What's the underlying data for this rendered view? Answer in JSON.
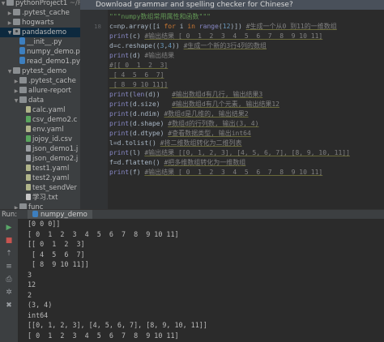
{
  "project_tree": {
    "items": [
      {
        "label": "pythonProject1",
        "suffix": "~/Pyt",
        "icon": "folder-icon",
        "indent": 0,
        "arrow": "down"
      },
      {
        "label": ".pytest_cache",
        "icon": "folder-icon",
        "indent": 1,
        "arrow": "right"
      },
      {
        "label": "hogwarts",
        "icon": "folder-icon",
        "indent": 1,
        "arrow": "right"
      },
      {
        "label": "pandasdemo",
        "icon": "package-icon",
        "indent": 1,
        "arrow": "down",
        "selected": true
      },
      {
        "label": "__init__.py",
        "icon": "python-file-icon",
        "indent": 2
      },
      {
        "label": "numpy_demo.py",
        "icon": "python-file-icon",
        "indent": 2
      },
      {
        "label": "read_demo1.py",
        "icon": "python-file-icon",
        "indent": 2
      },
      {
        "label": "pytest_demo",
        "icon": "folder-icon",
        "indent": 1,
        "arrow": "down"
      },
      {
        "label": ".pytest_cache",
        "icon": "folder-icon",
        "indent": 2,
        "arrow": "right"
      },
      {
        "label": "allure-report",
        "icon": "folder-icon",
        "indent": 2,
        "arrow": "right"
      },
      {
        "label": "data",
        "icon": "folder-icon",
        "indent": 2,
        "arrow": "down"
      },
      {
        "label": "calc.yaml",
        "icon": "yaml-file-icon",
        "indent": 3
      },
      {
        "label": "csv_demo2.c",
        "icon": "csv-file-icon",
        "indent": 3
      },
      {
        "label": "env.yaml",
        "icon": "yaml-file-icon",
        "indent": 3
      },
      {
        "label": "jojoy_id.csv",
        "icon": "csv-file-icon",
        "indent": 3
      },
      {
        "label": "json_demo1.j",
        "icon": "file-icon",
        "indent": 3
      },
      {
        "label": "json_demo2.j",
        "icon": "file-icon",
        "indent": 3
      },
      {
        "label": "test1.yaml",
        "icon": "yaml-file-icon",
        "indent": 3
      },
      {
        "label": "test2.yaml",
        "icon": "yaml-file-icon",
        "indent": 3
      },
      {
        "label": "test_sendVer",
        "icon": "yaml-file-icon",
        "indent": 3
      },
      {
        "label": "学习.txt",
        "icon": "text-file-icon",
        "indent": 3
      },
      {
        "label": "func",
        "icon": "folder-icon",
        "indent": 2,
        "arrow": "right"
      },
      {
        "label": "log",
        "icon": "folder-icon",
        "indent": 2,
        "arrow": "right"
      }
    ]
  },
  "notification": {
    "text": "Download grammar and spelling checker for Chinese?"
  },
  "editor": {
    "line_numbers": [
      "",
      "18",
      "",
      "",
      "",
      "",
      "",
      "",
      "",
      "",
      "",
      "",
      "",
      "",
      "",
      "",
      "",
      "",
      "",
      "",
      ""
    ],
    "lines": [
      {
        "segments": [
          {
            "t": "\"\"\"numpy数组常用属性和函数\"\"\"",
            "c": "doc"
          }
        ]
      },
      {
        "segments": [
          {
            "t": "c",
            "c": "plain"
          },
          {
            "t": "=np.array([i ",
            "c": "plain"
          },
          {
            "t": "for",
            "c": "kw"
          },
          {
            "t": " i ",
            "c": "plain"
          },
          {
            "t": "in",
            "c": "kw"
          },
          {
            "t": " ",
            "c": "plain"
          },
          {
            "t": "range",
            "c": "fn"
          },
          {
            "t": "(",
            "c": "plain"
          },
          {
            "t": "12",
            "c": "num"
          },
          {
            "t": ")]) ",
            "c": "plain"
          },
          {
            "t": "#生成一个从0 到11的一维数组",
            "c": "cmt-u"
          }
        ]
      },
      {
        "segments": [
          {
            "t": "print",
            "c": "fn"
          },
          {
            "t": "(c) ",
            "c": "plain"
          },
          {
            "t": "#输出结果 [ 0  1  2  3  4  5  6  7  8  9 10 11]",
            "c": "cmt-u"
          }
        ]
      },
      {
        "segments": [
          {
            "t": "d=c.reshape((",
            "c": "plain"
          },
          {
            "t": "3",
            "c": "num"
          },
          {
            "t": ",",
            "c": "plain"
          },
          {
            "t": "4",
            "c": "num"
          },
          {
            "t": ")) ",
            "c": "plain"
          },
          {
            "t": "#生成一个新的3行4列的数组",
            "c": "cmt-u"
          }
        ]
      },
      {
        "segments": [
          {
            "t": "print",
            "c": "fn"
          },
          {
            "t": "(d) ",
            "c": "plain"
          },
          {
            "t": "#输出结果",
            "c": "cmt"
          }
        ]
      },
      {
        "segments": [
          {
            "t": "#[[ 0  1  2  3]",
            "c": "cmt-u"
          }
        ]
      },
      {
        "segments": [
          {
            "t": " [ 4  5  6  7]",
            "c": "cmt-u"
          }
        ]
      },
      {
        "segments": [
          {
            "t": " [ 8  9 10 11]]",
            "c": "cmt-u"
          }
        ]
      },
      {
        "segments": [
          {
            "t": "print",
            "c": "fn"
          },
          {
            "t": "(",
            "c": "plain"
          },
          {
            "t": "len",
            "c": "fn"
          },
          {
            "t": "(d))   ",
            "c": "plain"
          },
          {
            "t": "#输出数组d有几行, 输出结果3",
            "c": "cmt-u"
          }
        ]
      },
      {
        "segments": [
          {
            "t": "print",
            "c": "fn"
          },
          {
            "t": "(d.size)   ",
            "c": "plain"
          },
          {
            "t": "#输出数组d有几个元素, 输出结果12",
            "c": "cmt-u"
          }
        ]
      },
      {
        "segments": [
          {
            "t": "print",
            "c": "fn"
          },
          {
            "t": "(d.ndim) ",
            "c": "plain"
          },
          {
            "t": "#数组d是几维的, 输出结果2",
            "c": "cmt-u"
          }
        ]
      },
      {
        "segments": [
          {
            "t": "print",
            "c": "fn"
          },
          {
            "t": "(d.shape) ",
            "c": "plain"
          },
          {
            "t": "#数组d的行列数, 输出(3, 4)",
            "c": "cmt-u"
          }
        ]
      },
      {
        "segments": [
          {
            "t": "print",
            "c": "fn"
          },
          {
            "t": "(d.dtype) ",
            "c": "plain"
          },
          {
            "t": "#查看数据类型, 输出int64",
            "c": "cmt-u"
          }
        ]
      },
      {
        "segments": [
          {
            "t": "l",
            "c": "plain"
          },
          {
            "t": "=d.tolist() ",
            "c": "plain"
          },
          {
            "t": "#将二维数组转化为二维列表",
            "c": "cmt-u"
          }
        ]
      },
      {
        "segments": [
          {
            "t": "print",
            "c": "fn"
          },
          {
            "t": "(l) ",
            "c": "plain"
          },
          {
            "t": "#输出结果 [[0, 1, 2, 3], [4, 5, 6, 7], [8, 9, 10, 11]]",
            "c": "cmt-u"
          }
        ]
      },
      {
        "segments": [
          {
            "t": "f",
            "c": "plain"
          },
          {
            "t": "=d.flatten() ",
            "c": "plain"
          },
          {
            "t": "#把多维数组转化为一维数组",
            "c": "cmt-u"
          }
        ]
      },
      {
        "segments": [
          {
            "t": "print",
            "c": "fn"
          },
          {
            "t": "(f) ",
            "c": "plain"
          },
          {
            "t": "#输出结果 [ 0  1  2  3  4  5  6  7  8  9 10 11]",
            "c": "cmt-u"
          }
        ]
      }
    ]
  },
  "run": {
    "label": "Run:",
    "tab_label": "numpy_demo",
    "output": [
      "[0 0 0]]",
      "[ 0  1  2  3  4  5  6  7  8  9 10 11]",
      "[[ 0  1  2  3]",
      " [ 4  5  6  7]",
      " [ 8  9 10 11]]",
      "3",
      "12",
      "2",
      "(3, 4)",
      "int64",
      "[[0, 1, 2, 3], [4, 5, 6, 7], [8, 9, 10, 11]]",
      "[ 0  1  2  3  4  5  6  7  8  9 10 11]"
    ],
    "tools": [
      "rerun-icon",
      "stop-icon",
      "pin-icon",
      "soft-wrap-icon",
      "print-icon",
      "settings-icon",
      "delete-icon"
    ]
  }
}
